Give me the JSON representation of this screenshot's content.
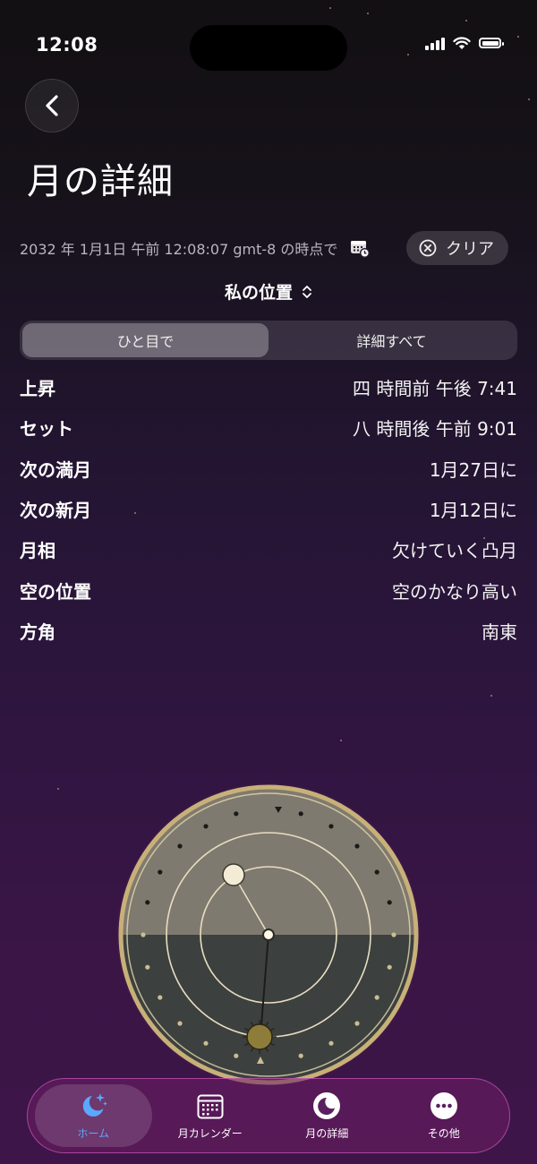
{
  "status_bar": {
    "time": "12:08"
  },
  "header": {
    "back_label": "",
    "title": "月の詳細"
  },
  "timestamp": {
    "text": "2032 年 1月1日 午前 12:08:07 gmt-8 の時点で",
    "clear_label": "クリア"
  },
  "location": {
    "label": "私の位置"
  },
  "segmented": {
    "options": [
      "ひと目で",
      "詳細すべて"
    ],
    "selected": "ひと目で"
  },
  "details": [
    {
      "label": "上昇",
      "value": "四 時間前 午後 7:41"
    },
    {
      "label": "セット",
      "value": "八 時間後 午前 9:01"
    },
    {
      "label": "次の満月",
      "value": "1月27日に"
    },
    {
      "label": "次の新月",
      "value": "1月12日に"
    },
    {
      "label": "月相",
      "value": "欠けていく凸月"
    },
    {
      "label": "空の位置",
      "value": "空のかなり高い"
    },
    {
      "label": "方角",
      "value": "南東"
    }
  ],
  "tabs": [
    {
      "label": "ホーム",
      "icon": "moon-stars-icon",
      "active": true
    },
    {
      "label": "月カレンダー",
      "icon": "calendar-icon",
      "active": false
    },
    {
      "label": "月の詳細",
      "icon": "moon-icon",
      "active": false
    },
    {
      "label": "その他",
      "icon": "more-icon",
      "active": false
    }
  ],
  "colors": {
    "accent": "#5aa8ff",
    "sky_upper": "#7f7a6f",
    "sky_lower": "#3c413f",
    "dial_rim": "#c8b078"
  }
}
